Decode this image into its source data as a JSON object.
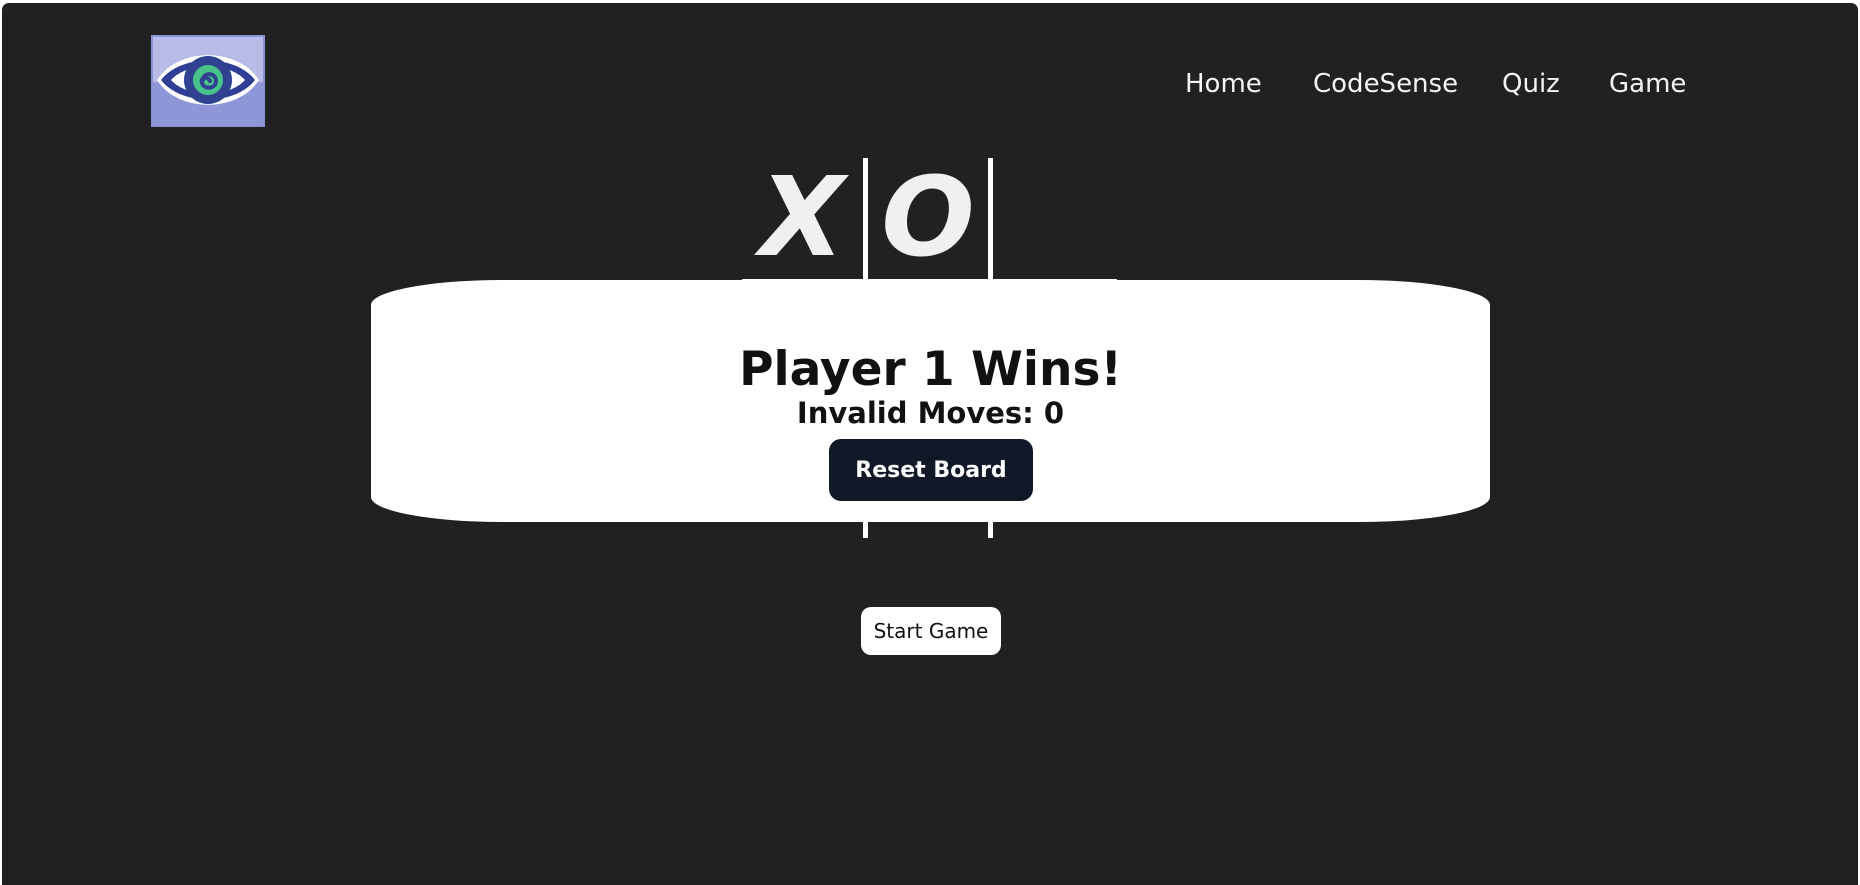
{
  "nav": {
    "items": [
      {
        "label": "Home"
      },
      {
        "label": "CodeSense"
      },
      {
        "label": "Quiz"
      },
      {
        "label": "Game"
      }
    ]
  },
  "game": {
    "cells": [
      "X",
      "O",
      "",
      "",
      "",
      "",
      "",
      "",
      ""
    ],
    "result_title": "Player 1 Wins!",
    "invalid_moves": "Invalid Moves: 0",
    "reset_label": "Reset Board",
    "start_label": "Start Game"
  },
  "colors": {
    "page_background": "#212121",
    "modal_background": "#ffffff",
    "reset_button": "#111827",
    "logo_blue": "#2f3f98",
    "logo_green": "#48c48b"
  }
}
